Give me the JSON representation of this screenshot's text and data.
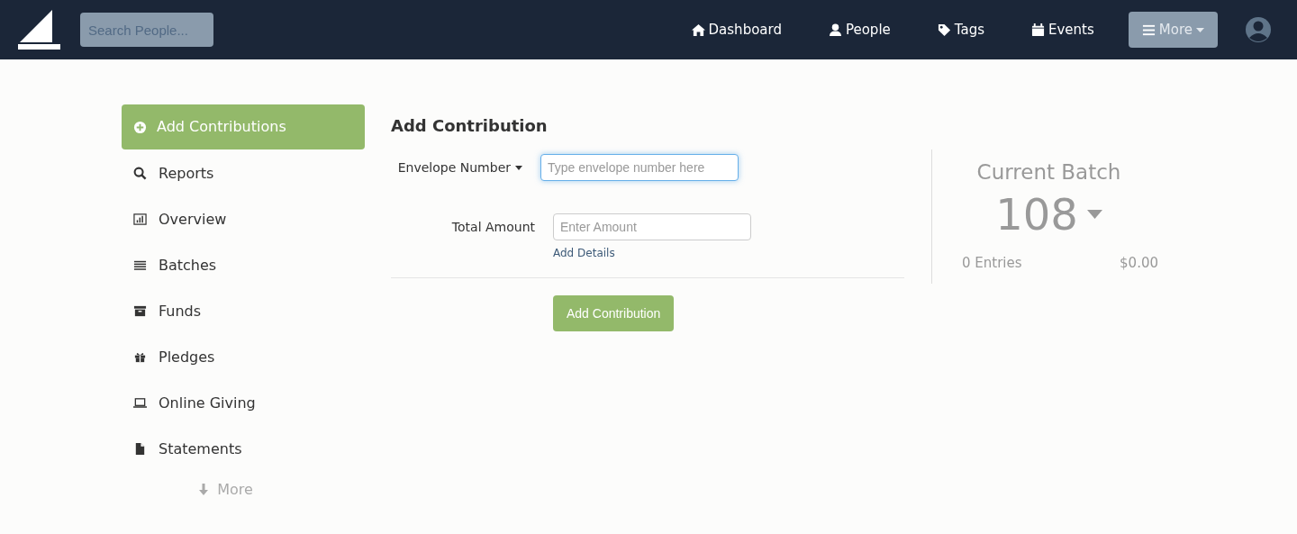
{
  "header": {
    "search": {
      "placeholder": "Search People..."
    },
    "nav": [
      {
        "label": "Dashboard",
        "selected": false
      },
      {
        "label": "People",
        "selected": false
      },
      {
        "label": "Tags",
        "selected": false
      },
      {
        "label": "Events",
        "selected": false
      },
      {
        "label": "More",
        "selected": true
      }
    ]
  },
  "sidebar": {
    "items": [
      {
        "label": "Add Contributions",
        "selected": true
      },
      {
        "label": "Reports",
        "selected": false
      },
      {
        "label": "Overview",
        "selected": false
      },
      {
        "label": "Batches",
        "selected": false
      },
      {
        "label": "Funds",
        "selected": false
      },
      {
        "label": "Pledges",
        "selected": false
      },
      {
        "label": "Online Giving",
        "selected": false
      },
      {
        "label": "Statements",
        "selected": false
      }
    ],
    "more": "More"
  },
  "form": {
    "title": "Add Contribution",
    "fields": [
      {
        "label": "Envelope Number",
        "dropdown": true,
        "placeholder": "Type envelope number here",
        "focused": true
      },
      {
        "label": "Total Amount",
        "dropdown": false,
        "placeholder": "Enter Amount",
        "focused": false
      }
    ],
    "details_link": "Add Details",
    "submit": "Add Contribution"
  },
  "batch": {
    "title": "Current Batch",
    "number": "108",
    "entries": "0 Entries",
    "total": "$0.00"
  }
}
